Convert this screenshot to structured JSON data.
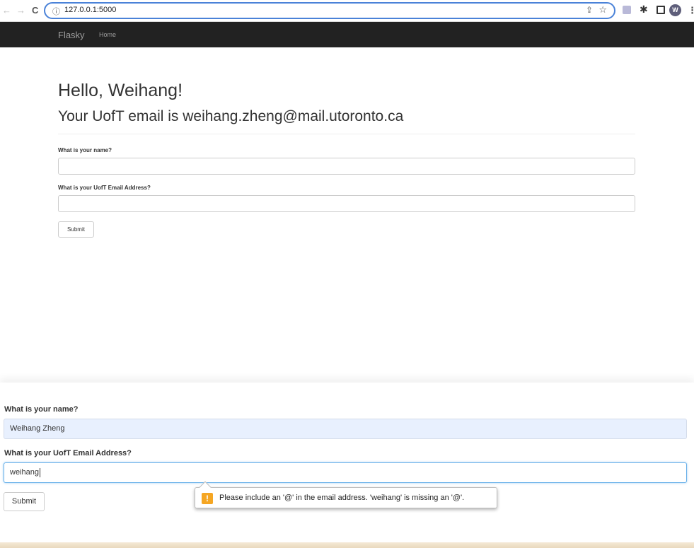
{
  "browser": {
    "url": "127.0.0.1:5000",
    "profile_initial": "W",
    "back_icon": "arrow-left-icon",
    "forward_icon": "arrow-right-icon",
    "reload_icon": "reload-icon"
  },
  "navbar": {
    "brand": "Flasky",
    "links": [
      "Home"
    ]
  },
  "page": {
    "greeting": "Hello, Weihang!",
    "email_line": "Your UofT email is weihang.zheng@mail.utoronto.ca",
    "form": {
      "name_label": "What is your name?",
      "name_value": "",
      "email_label": "What is your UofT Email Address?",
      "email_value": "",
      "submit_label": "Submit"
    }
  },
  "zoomed_form": {
    "name_label": "What is your name?",
    "name_value": "Weihang Zheng",
    "email_label": "What is your UofT Email Address?",
    "email_value": "weihang",
    "submit_label": "Submit",
    "validation_message": "Please include an '@' in the email address. 'weihang' is missing an '@'."
  },
  "colors": {
    "navbar_bg": "#222222",
    "focus_border": "#66afe9",
    "autofill_bg": "#e8f0fe",
    "warning": "#f5a623"
  }
}
